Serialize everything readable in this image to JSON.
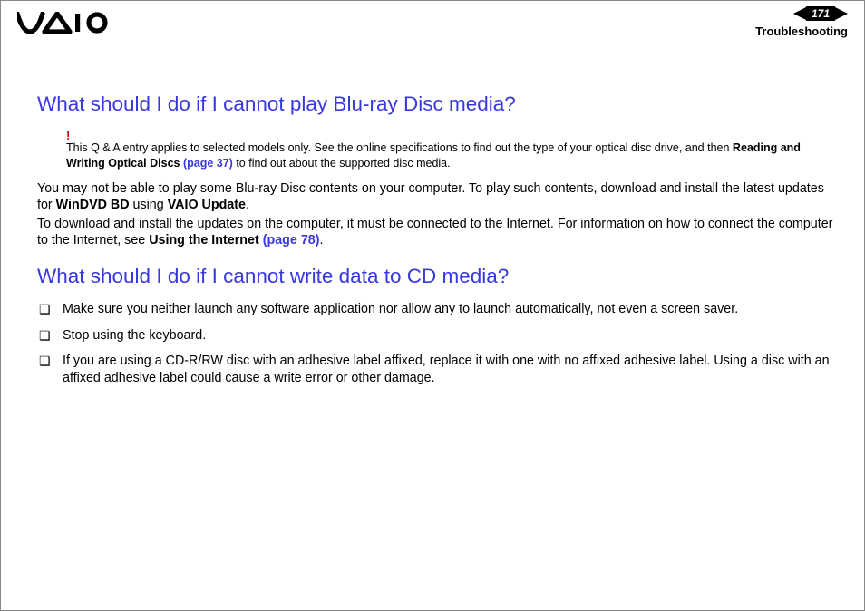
{
  "header": {
    "page_number": "171",
    "section": "Troubleshooting"
  },
  "section1": {
    "title": "What should I do if I cannot play Blu-ray Disc media?",
    "bang": "!",
    "note_pre": "This Q & A entry applies to selected models only. See the online specifications to find out the type of your optical disc drive, and then ",
    "note_bold": "Reading and Writing Optical Discs ",
    "note_link": "(page 37)",
    "note_post": " to find out about the supported disc media.",
    "para1_pre": "You may not be able to play some Blu-ray Disc contents on your computer. To play such contents, download and install the latest updates for ",
    "para1_b1": "WinDVD BD",
    "para1_mid": " using ",
    "para1_b2": "VAIO Update",
    "para1_post": ".",
    "para2_pre": "To download and install the updates on the computer, it must be connected to the Internet. For information on how to connect the computer to the Internet, see ",
    "para2_b": "Using the Internet ",
    "para2_link": "(page 78)",
    "para2_post": "."
  },
  "section2": {
    "title": "What should I do if I cannot write data to CD media?",
    "items": [
      "Make sure you neither launch any software application nor allow any to launch automatically, not even a screen saver.",
      "Stop using the keyboard.",
      "If you are using a CD-R/RW disc with an adhesive label affixed, replace it with one with no affixed adhesive label. Using a disc with an affixed adhesive label could cause a write error or other damage."
    ]
  }
}
